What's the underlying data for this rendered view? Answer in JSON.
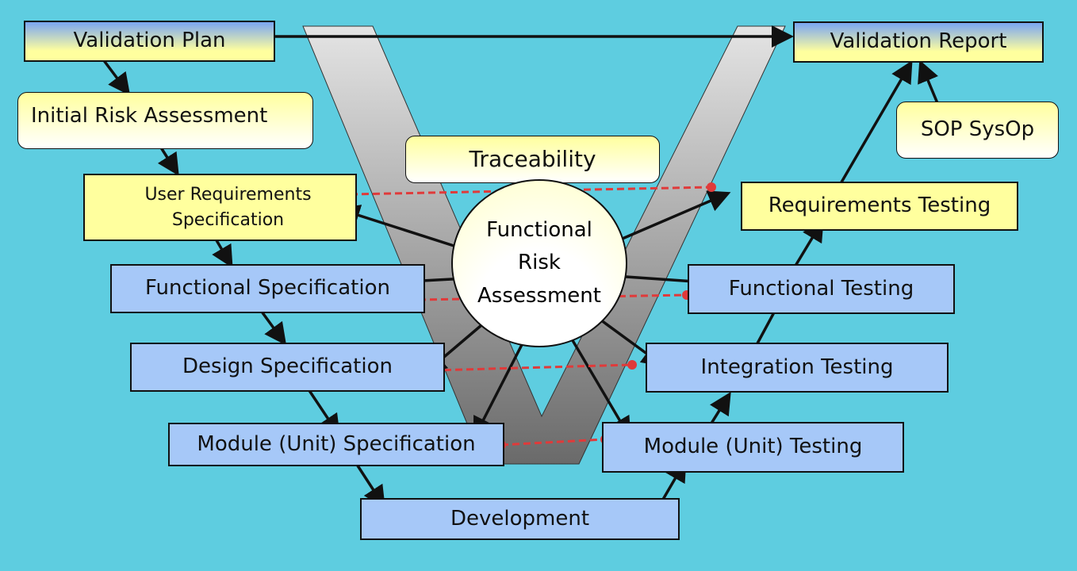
{
  "colors": {
    "background": "#5ecde0",
    "yellow_box": "#ffff9e",
    "blue_box": "#a6c8f8",
    "trace_line": "#e03a3a"
  },
  "boxes": {
    "validation_plan": "Validation Plan",
    "validation_report": "Validation Report",
    "initial_risk": "Initial Risk Assessment",
    "sop": "SOP SysOp",
    "traceability": "Traceability",
    "urs_line1": "User Requirements",
    "urs_line2": "Specification",
    "req_testing": "Requirements Testing",
    "func_spec": "Functional Specification",
    "func_testing": "Functional Testing",
    "design_spec": "Design Specification",
    "integration_testing": "Integration Testing",
    "module_spec": "Module (Unit) Specification",
    "module_testing": "Module (Unit) Testing",
    "development": "Development"
  },
  "center": {
    "line1": "Functional",
    "line2": "Risk",
    "line3": "Assessment"
  }
}
